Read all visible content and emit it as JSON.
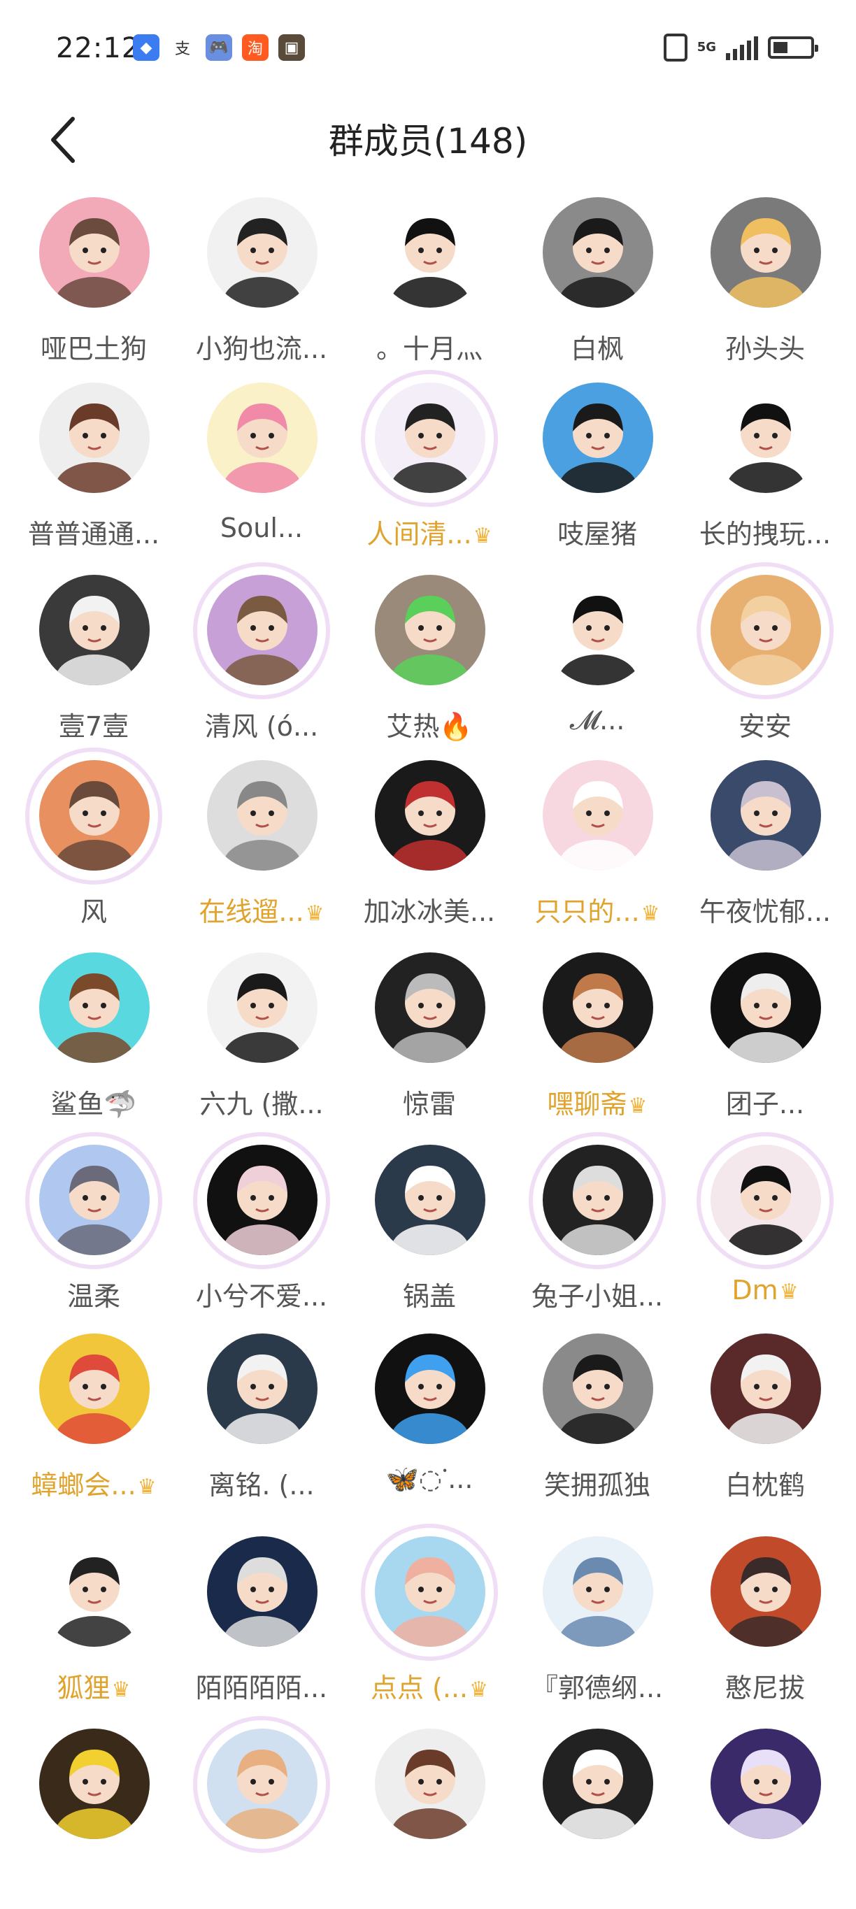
{
  "status_bar": {
    "time": "22:12",
    "net_label": "5G",
    "apps": [
      {
        "icon": "blue-app-icon",
        "color": "#3b7df0",
        "text": "◆"
      },
      {
        "icon": "alipay-icon",
        "color": "#ffffff",
        "text": "支"
      },
      {
        "icon": "game-app-icon",
        "color": "#6a8fe0",
        "text": "🎮"
      },
      {
        "icon": "taobao-icon",
        "color": "#ff5a1f",
        "text": "淘"
      },
      {
        "icon": "photo-app-icon",
        "color": "#5a4a3a",
        "text": "▣"
      }
    ],
    "battery_level": 0.4
  },
  "header": {
    "back_icon": "chevron-left-icon",
    "title": "群成员(148)"
  },
  "members": [
    {
      "name": "哑巴土狗",
      "vip": false,
      "bg": "#f2a9b8",
      "fg": "#6b4b3e"
    },
    {
      "name": "小狗也流...",
      "vip": false,
      "bg": "#f1f1f1",
      "fg": "#222222"
    },
    {
      "name": "。十月灬",
      "vip": false,
      "bg": "#ffffff",
      "fg": "#111111"
    },
    {
      "name": "白枫",
      "vip": false,
      "bg": "#8a8a8a",
      "fg": "#1a1a1a"
    },
    {
      "name": "孙头头",
      "vip": false,
      "bg": "#7a7a7a",
      "fg": "#f0c060"
    },
    {
      "name": "普普通通...",
      "vip": false,
      "bg": "#eeeeee",
      "fg": "#6b3b2a"
    },
    {
      "name": "Soul...",
      "vip": false,
      "bg": "#fbf1c8",
      "fg": "#f08aa8"
    },
    {
      "name": "人间清...",
      "vip": true,
      "bg": "#f4eef8",
      "fg": "#222222",
      "frame": true
    },
    {
      "name": "吱屋猪",
      "vip": false,
      "bg": "#4aa0e0",
      "fg": "#1a1a1a"
    },
    {
      "name": "长的拽玩...",
      "vip": false,
      "bg": "#ffffff",
      "fg": "#111111"
    },
    {
      "name": "壹7壹",
      "vip": false,
      "bg": "#3a3a3a",
      "fg": "#f2f2f2"
    },
    {
      "name": "清风 (ό...",
      "vip": false,
      "bg": "#c8a0d8",
      "fg": "#7a5a40",
      "frame": true
    },
    {
      "name": "艾热🔥",
      "vip": false,
      "bg": "#9a8a7a",
      "fg": "#5ad05a"
    },
    {
      "name": "𝓜...",
      "vip": false,
      "bg": "#ffffff",
      "fg": "#111111"
    },
    {
      "name": "安安",
      "vip": false,
      "bg": "#e8b070",
      "fg": "#f2d0a0",
      "frame": true
    },
    {
      "name": "风",
      "vip": false,
      "bg": "#e89060",
      "fg": "#6a4a3a",
      "frame": true
    },
    {
      "name": "在线遛...",
      "vip": true,
      "bg": "#dddddd",
      "fg": "#888888"
    },
    {
      "name": "加冰冰美...",
      "vip": false,
      "bg": "#1a1a1a",
      "fg": "#c03030"
    },
    {
      "name": "只只的...",
      "vip": true,
      "bg": "#f8d8e0",
      "fg": "#ffffff"
    },
    {
      "name": "午夜忧郁...",
      "vip": false,
      "bg": "#3a4a6a",
      "fg": "#c8c0d0"
    },
    {
      "name": "鲨鱼🦈",
      "vip": false,
      "bg": "#5ad8e0",
      "fg": "#7a4a2a"
    },
    {
      "name": "六九 (撒...",
      "vip": false,
      "bg": "#f2f2f2",
      "fg": "#1a1a1a"
    },
    {
      "name": "惊雷",
      "vip": false,
      "bg": "#222222",
      "fg": "#bbbbbb"
    },
    {
      "name": "嘿聊斋",
      "vip": true,
      "bg": "#1a1a1a",
      "fg": "#c07a4a"
    },
    {
      "name": "团子...",
      "vip": false,
      "bg": "#111111",
      "fg": "#eeeeee"
    },
    {
      "name": "温柔",
      "vip": false,
      "bg": "#b0c8f0",
      "fg": "#6a6a7a",
      "frame": true
    },
    {
      "name": "小兮不爱...",
      "vip": false,
      "bg": "#111111",
      "fg": "#f0d0d8",
      "frame": true
    },
    {
      "name": "锅盖",
      "vip": false,
      "bg": "#2a3a4a",
      "fg": "#ffffff"
    },
    {
      "name": "兔子小姐...",
      "vip": false,
      "bg": "#222222",
      "fg": "#dddddd",
      "frame": true
    },
    {
      "name": "Dm",
      "vip": true,
      "bg": "#f4e8ec",
      "fg": "#111111",
      "frame": true
    },
    {
      "name": "蟑螂会...",
      "vip": true,
      "bg": "#f2c63a",
      "fg": "#e04a3a"
    },
    {
      "name": "离铭. (...",
      "vip": false,
      "bg": "#2a3a4a",
      "fg": "#f2f2f2"
    },
    {
      "name": "🦋◌ᣟ...",
      "vip": false,
      "bg": "#111111",
      "fg": "#40a0f0"
    },
    {
      "name": "笑拥孤独",
      "vip": false,
      "bg": "#8a8a8a",
      "fg": "#1a1a1a"
    },
    {
      "name": "白枕鹤",
      "vip": false,
      "bg": "#5a2a2a",
      "fg": "#f2f2f2"
    },
    {
      "name": "狐狸",
      "vip": true,
      "bg": "#ffffff",
      "fg": "#222222"
    },
    {
      "name": "陌陌陌陌...",
      "vip": false,
      "bg": "#1a2a4a",
      "fg": "#dddddd"
    },
    {
      "name": "点点 (...",
      "vip": true,
      "bg": "#a8d8f0",
      "fg": "#f0b0a0",
      "frame": true
    },
    {
      "name": "『郭德纲...",
      "vip": false,
      "bg": "#e8f0f8",
      "fg": "#6a8ab0"
    },
    {
      "name": "憨尼拔",
      "vip": false,
      "bg": "#c04a2a",
      "fg": "#3a2a2a"
    },
    {
      "name": "",
      "vip": false,
      "bg": "#3a2a1a",
      "fg": "#f2d030"
    },
    {
      "name": "",
      "vip": false,
      "bg": "#d0e0f0",
      "fg": "#e8b080",
      "frame": true
    },
    {
      "name": "",
      "vip": false,
      "bg": "#eeeeee",
      "fg": "#6b3b2a"
    },
    {
      "name": "",
      "vip": false,
      "bg": "#222222",
      "fg": "#ffffff"
    },
    {
      "name": "",
      "vip": false,
      "bg": "#3a2a6a",
      "fg": "#e8e0f8"
    }
  ]
}
